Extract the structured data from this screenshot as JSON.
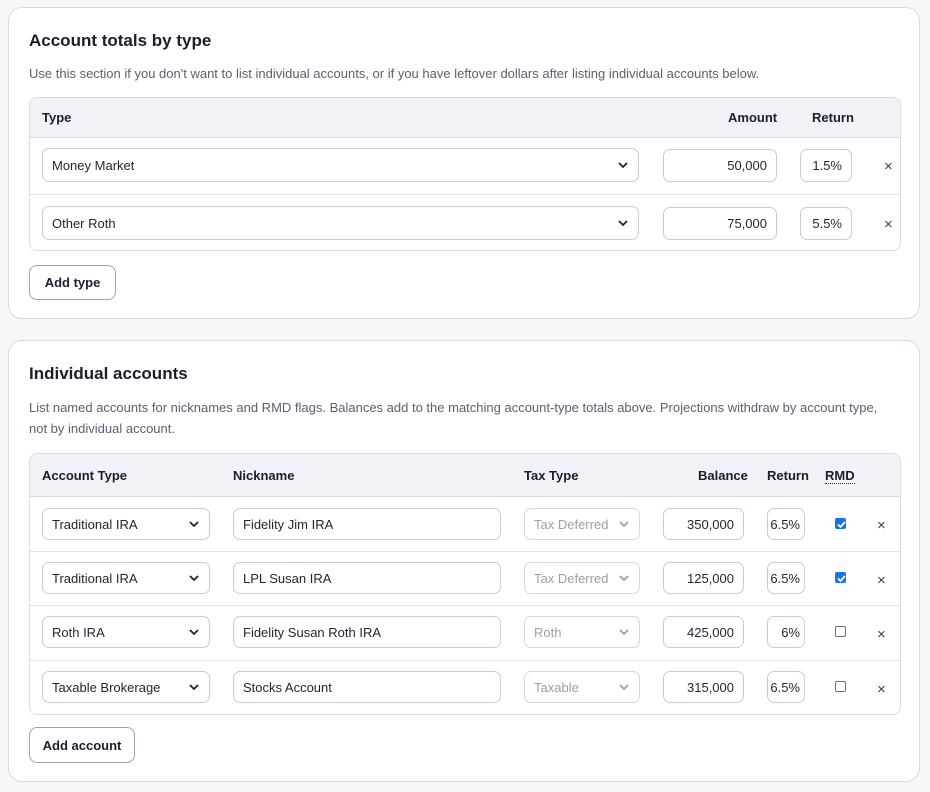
{
  "totals": {
    "title": "Account totals by type",
    "description": "Use this section if you don't want to list individual accounts, or if you have leftover dollars after listing individual accounts below.",
    "headers": {
      "type": "Type",
      "amount": "Amount",
      "return": "Return"
    },
    "rows": [
      {
        "type": "Money Market",
        "amount": "50,000",
        "return": "1.5%"
      },
      {
        "type": "Other Roth",
        "amount": "75,000",
        "return": "5.5%"
      }
    ],
    "add_label": "Add type",
    "remove_glyph": "×"
  },
  "individual": {
    "title": "Individual accounts",
    "description": "List named accounts for nicknames and RMD flags. Balances add to the matching account-type totals above. Projections withdraw by account type, not by individual account.",
    "headers": {
      "account_type": "Account Type",
      "nickname": "Nickname",
      "tax_type": "Tax Type",
      "balance": "Balance",
      "return": "Return",
      "rmd": "RMD"
    },
    "rows": [
      {
        "account_type": "Traditional IRA",
        "nickname": "Fidelity Jim IRA",
        "tax_type": "Tax Deferred",
        "balance": "350,000",
        "return": "6.5%",
        "rmd": true
      },
      {
        "account_type": "Traditional IRA",
        "nickname": "LPL Susan IRA",
        "tax_type": "Tax Deferred",
        "balance": "125,000",
        "return": "6.5%",
        "rmd": true
      },
      {
        "account_type": "Roth IRA",
        "nickname": "Fidelity Susan Roth IRA",
        "tax_type": "Roth",
        "balance": "425,000",
        "return": "6%",
        "rmd": false
      },
      {
        "account_type": "Taxable Brokerage",
        "nickname": "Stocks Account",
        "tax_type": "Taxable",
        "balance": "315,000",
        "return": "6.5%",
        "rmd": false
      }
    ],
    "add_label": "Add account",
    "remove_glyph": "×"
  },
  "colors": {
    "checkbox_on": "#1a73e8",
    "header_bg": "#f1f2f7"
  }
}
